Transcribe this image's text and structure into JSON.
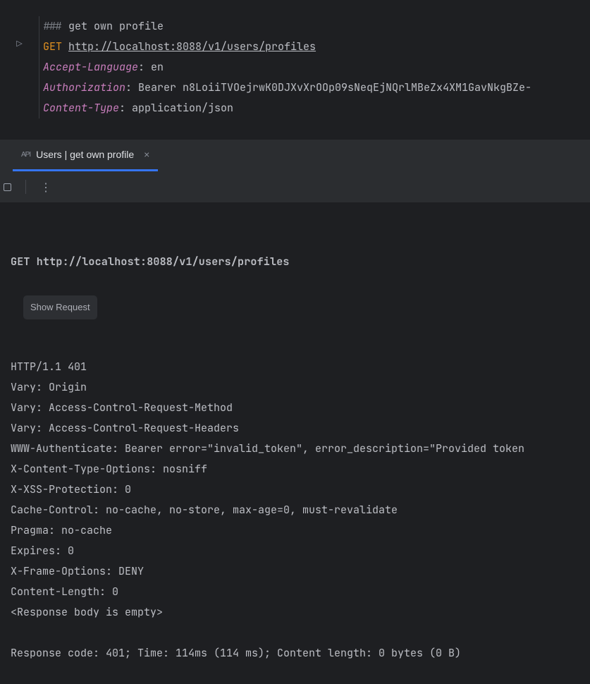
{
  "editor": {
    "comment_prefix": "###",
    "comment": "get own profile",
    "method": "GET",
    "url": "http://localhost:8088/v1/users/profiles",
    "headers": {
      "accept_language": {
        "name": "Accept-Language",
        "value": "en"
      },
      "authorization": {
        "name": "Authorization",
        "value": "Bearer n8LoiiTVOejrwK0DJXvXrOOp09sNeqEjNQrlMBeZx4XM1GavNkgBZe-"
      },
      "content_type": {
        "name": "Content-Type",
        "value": "application/json"
      }
    }
  },
  "tab": {
    "label": "Users | get own profile"
  },
  "response": {
    "request_line": "GET http://localhost:8088/v1/users/profiles",
    "show_request_label": "Show Request",
    "status_line": "HTTP/1.1 401",
    "headers": [
      "Vary: Origin",
      "Vary: Access-Control-Request-Method",
      "Vary: Access-Control-Request-Headers",
      "WWW-Authenticate: Bearer error=\"invalid_token\", error_description=\"Provided token",
      "X-Content-Type-Options: nosniff",
      "X-XSS-Protection: 0",
      "Cache-Control: no-cache, no-store, max-age=0, must-revalidate",
      "Pragma: no-cache",
      "Expires: 0",
      "X-Frame-Options: DENY",
      "Content-Length: 0"
    ],
    "body_note": "<Response body is empty>",
    "summary": "Response code: 401; Time: 114ms (114 ms); Content length: 0 bytes (0 B)"
  }
}
